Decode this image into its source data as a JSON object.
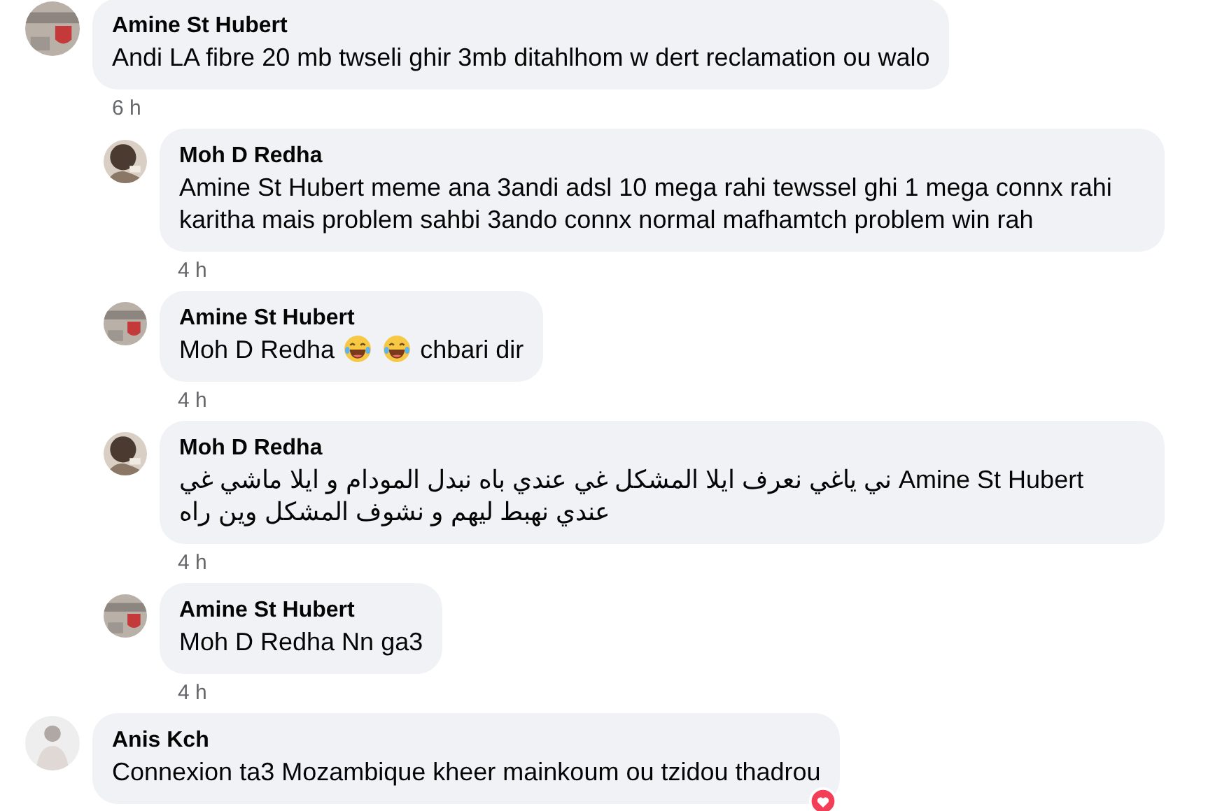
{
  "comments": [
    {
      "author": "Amine St Hubert",
      "parts": [
        {
          "kind": "text",
          "text": "Andi LA fibre 20 mb twseli ghir 3mb ditahlhom w dert reclamation ou walo"
        }
      ],
      "time": "6 h",
      "replies": [
        {
          "author": "Moh D Redha",
          "parts": [
            {
              "kind": "text",
              "text": "Amine St Hubert meme ana 3andi adsl 10 mega rahi tewssel ghi 1 mega connx rahi karitha mais problem sahbi 3ando connx normal mafhamtch problem win rah"
            }
          ],
          "time": "4 h"
        },
        {
          "author": "Amine St Hubert",
          "parts": [
            {
              "kind": "text",
              "text": "Moh D Redha"
            },
            {
              "kind": "emoji"
            },
            {
              "kind": "emoji"
            },
            {
              "kind": "text",
              "text": "chbari dir"
            }
          ],
          "time": "4 h"
        },
        {
          "author": "Moh D Redha",
          "rtl": true,
          "parts": [
            {
              "kind": "text",
              "text": "Amine St Hubert ني ياغي نعرف ايلا المشكل غي عندي باه نبدل المودام و ايلا ماشي غي عندي نهبط ليهم و نشوف المشكل وين راه"
            }
          ],
          "time": "4 h"
        },
        {
          "author": "Amine St Hubert",
          "parts": [
            {
              "kind": "text",
              "text": "Moh D Redha Nn ga3"
            }
          ],
          "time": "4 h"
        }
      ]
    },
    {
      "author": "Anis Kch",
      "parts": [
        {
          "kind": "text",
          "text": "Connexion ta3 Mozambique kheer mainkoum ou tzidou thadrou"
        }
      ],
      "reaction": true
    }
  ]
}
